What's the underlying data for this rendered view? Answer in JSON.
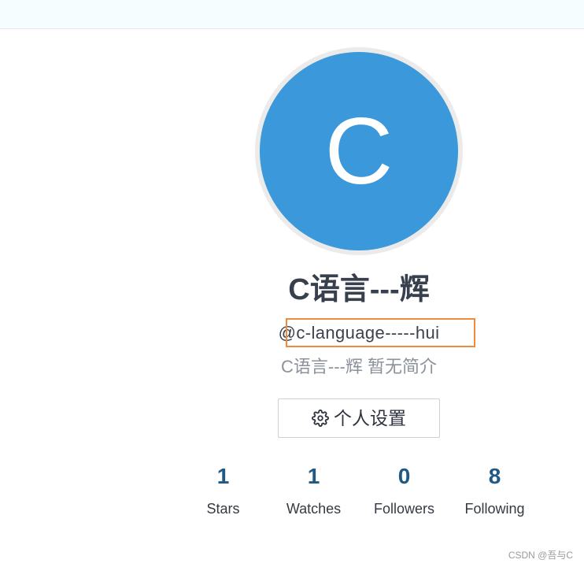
{
  "profile": {
    "avatar": {
      "letter": "C",
      "background": "#3a98db"
    },
    "display_name": "C语言---辉",
    "username": "@c-language-----hui",
    "bio": "C语言---辉 暂无简介",
    "settings_button": {
      "icon": "gear-icon",
      "label": "个人设置"
    }
  },
  "stats": [
    {
      "value": "1",
      "label": "Stars"
    },
    {
      "value": "1",
      "label": "Watches"
    },
    {
      "value": "0",
      "label": "Followers"
    },
    {
      "value": "8",
      "label": "Following"
    }
  ],
  "watermark": "CSDN @吾与C",
  "colors": {
    "accent": "#3a98db",
    "stat_value": "#205a84",
    "highlight": "#ef8b3c",
    "text_muted": "#8b919b"
  }
}
